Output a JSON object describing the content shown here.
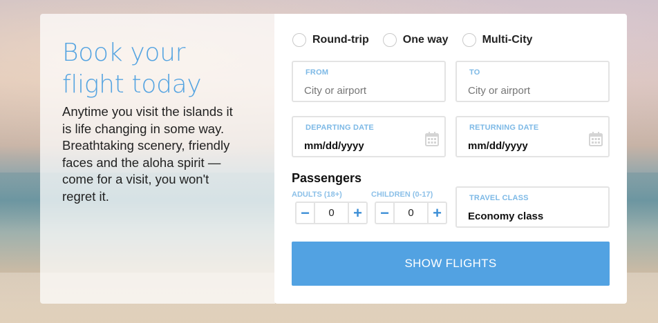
{
  "hero": {
    "headline": "Book your flight today",
    "blurb": "Anytime you visit the islands it is life changing in some way. Breathtaking scenery, friendly faces and the aloha spirit — come for a visit, you won't regret it."
  },
  "trip_type": {
    "options": [
      "Round-trip",
      "One way",
      "Multi-City"
    ]
  },
  "from": {
    "label": "FROM",
    "placeholder": "City or airport"
  },
  "to": {
    "label": "TO",
    "placeholder": "City or airport"
  },
  "departing": {
    "label": "DEPARTING DATE",
    "value": "mm/dd/yyyy"
  },
  "returning": {
    "label": "RETURNING DATE",
    "value": "mm/dd/yyyy"
  },
  "passengers": {
    "title": "Passengers",
    "adults": {
      "label": "ADULTS (18+)",
      "value": "0"
    },
    "children": {
      "label": "CHILDREN (0-17)",
      "value": "0"
    },
    "minus": "−",
    "plus": "+"
  },
  "travel_class": {
    "label": "TRAVEL CLASS",
    "value": "Economy class"
  },
  "submit": {
    "label": "SHOW FLIGHTS"
  },
  "icons": {
    "radio": "radio-circle-icon",
    "calendar": "calendar-icon",
    "minus": "minus-icon",
    "plus": "plus-icon"
  },
  "colors": {
    "accent": "#52a2e2",
    "headline": "#55a4e1",
    "field_label": "#7db9e6"
  }
}
